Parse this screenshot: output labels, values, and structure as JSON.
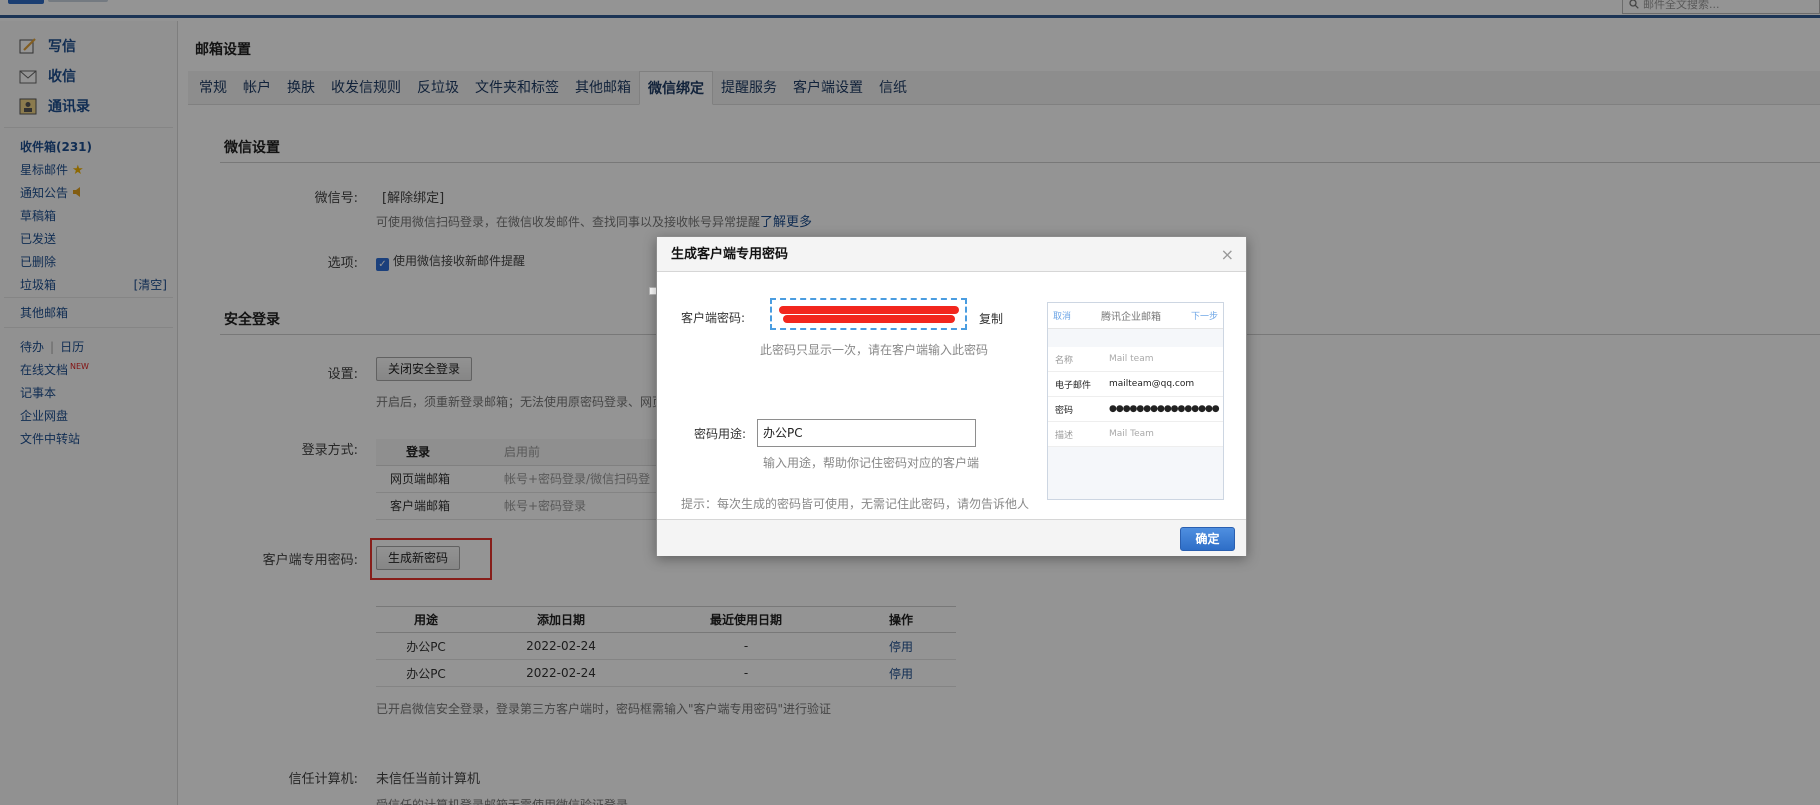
{
  "topbar": {
    "search_placeholder": "邮件全文搜索..."
  },
  "sidebar": {
    "main": [
      {
        "label": "写信",
        "icon": "compose-icon"
      },
      {
        "label": "收信",
        "icon": "inbox-icon"
      },
      {
        "label": "通讯录",
        "icon": "contacts-icon"
      }
    ],
    "folders": [
      {
        "label": "收件箱(231)"
      },
      {
        "label": "星标邮件"
      },
      {
        "label": "通知公告"
      },
      {
        "label": "草稿箱"
      },
      {
        "label": "已发送"
      },
      {
        "label": "已删除"
      },
      {
        "label": "垃圾箱",
        "extra": "[清空]"
      }
    ],
    "other_mail": "其他邮箱",
    "todo": "待办",
    "separator": "|",
    "calendar": "日历",
    "online_docs": "在线文档",
    "new_badge": "NEW",
    "notes": "记事本",
    "netdisk": "企业网盘",
    "transfer": "文件中转站"
  },
  "main": {
    "title": "邮箱设置",
    "tabs": [
      "常规",
      "帐户",
      "换肤",
      "收发信规则",
      "反垃圾",
      "文件夹和标签",
      "其他邮箱",
      "微信绑定",
      "提醒服务",
      "客户端设置",
      "信纸"
    ],
    "active_tab": 7,
    "wechat_section": "微信设置",
    "wechat_label": "微信号:",
    "unbind": "[解除绑定]",
    "wechat_hint": "可使用微信扫码登录，在微信收发邮件、查找同事以及接收帐号异常提醒",
    "learn_more": "了解更多",
    "options_label": "选项:",
    "options_check": "使用微信接收新邮件提醒",
    "security_section": "安全登录",
    "settings_label": "设置:",
    "close_secure_btn": "关闭安全登录",
    "secure_hint": "开启后，须重新登录邮箱；无法使用原密码登录、网页",
    "login_method_label": "登录方式:",
    "login_table": {
      "headers": [
        "登录",
        "启用前"
      ],
      "rows": [
        [
          "网页端邮箱",
          "帐号+密码登录/微信扫码登"
        ],
        [
          "客户端邮箱",
          "帐号+密码登录"
        ]
      ]
    },
    "client_pw_label": "客户端专用密码:",
    "gen_btn": "生成新密码",
    "pw_table": {
      "headers": [
        "用途",
        "添加日期",
        "最近使用日期",
        "操作"
      ],
      "rows": [
        [
          "办公PC",
          "2022-02-24",
          "-",
          "停用"
        ],
        [
          "办公PC",
          "2022-02-24",
          "-",
          "停用"
        ]
      ]
    },
    "pw_hint": "已开启微信安全登录，登录第三方客户端时，密码框需输入\"客户端专用密码\"进行验证",
    "trust_label": "信任计算机:",
    "trust_value": "未信任当前计算机",
    "trust_hint": "受信任的计算机登录邮箱无需使用微信验证登录"
  },
  "dialog": {
    "title": "生成客户端专用密码",
    "close": "×",
    "pw_label": "客户端密码:",
    "copy": "复制",
    "pw_hint": "此密码只显示一次，请在客户端输入此密码",
    "usage_label": "密码用途:",
    "usage_value": "办公PC",
    "usage_hint": "输入用途，帮助你记住密码对应的客户端",
    "tip": "提示：每次生成的密码皆可使用，无需记住此密码，请勿告诉他人",
    "ok": "确定",
    "phone": {
      "cancel": "取消",
      "title": "腾讯企业邮箱",
      "next": "下一步",
      "rows": [
        {
          "k": "名称",
          "v": "Mail team"
        },
        {
          "k": "电子邮件",
          "v": "mailteam@qq.com"
        },
        {
          "k": "密码",
          "v": "●●●●●●●●●●●●●●●●"
        },
        {
          "k": "描述",
          "v": "Mail Team"
        }
      ]
    }
  }
}
